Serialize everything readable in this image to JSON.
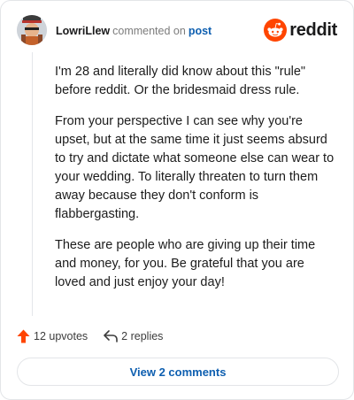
{
  "comment": {
    "username": "LowriLlew",
    "action_text": "commented on",
    "post_link": "post",
    "brand": "reddit",
    "paragraphs": [
      "I'm 28 and literally did know about this \"rule\" before reddit. Or the bridesmaid dress rule.",
      "From your perspective I can see why you're upset, but at the same time it just seems absurd to try and dictate what someone else can wear to your wedding. To literally threaten to turn them away because they don't conform is flabbergasting.",
      "These are people who are giving up their time and money, for you. Be grateful that you are loved and just enjoy your day!"
    ]
  },
  "actions": {
    "upvotes": "12 upvotes",
    "replies": "2 replies"
  },
  "footer": {
    "view_comments": "View 2 comments"
  },
  "colors": {
    "accent": "#ff4500",
    "link": "#0e5fb0"
  },
  "icons": {
    "brand": "reddit-snoo-icon",
    "upvote": "upvote-arrow-icon",
    "reply": "reply-arrow-icon"
  }
}
